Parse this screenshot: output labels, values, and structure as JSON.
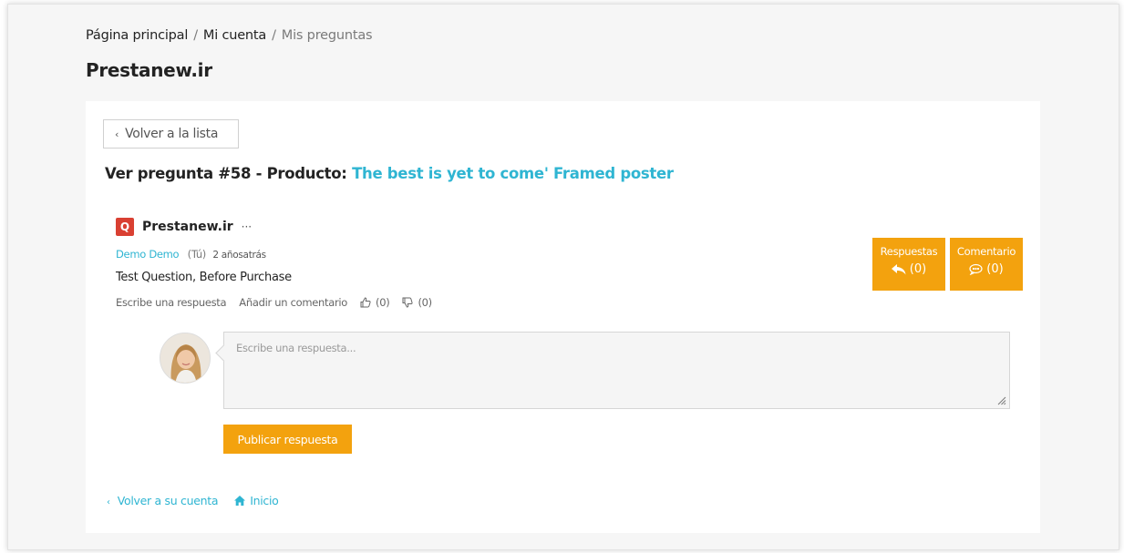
{
  "breadcrumb": {
    "items": [
      "Página principal",
      "Mi cuenta"
    ],
    "current": "Mis preguntas",
    "separator": "/"
  },
  "page": {
    "title": "Prestanew.ir"
  },
  "question": {
    "back_label": "Volver a la lista",
    "heading_prefix": "Ver pregunta #58 - Producto:",
    "product_name": "The best is yet to come' Framed poster",
    "shop_logo_letter": "Q",
    "shop_name": "Prestanew.ir",
    "more": "···",
    "author": "Demo Demo",
    "you_label": "(Tú)",
    "time": "2 añosatrás",
    "text": "Test Question, Before Purchase",
    "write_reply": "Escribe una respuesta",
    "add_comment": "Añadir un comentario",
    "likes": "(0)",
    "dislikes": "(0)"
  },
  "stats": {
    "answers_label": "Respuestas",
    "answers_count": "(0)",
    "comments_label": "Comentario",
    "comments_count": "(0)"
  },
  "reply": {
    "placeholder": "Escribe una respuesta...",
    "publish_label": "Publicar respuesta"
  },
  "footer": {
    "back_account": "Volver a su cuenta",
    "home": "Inicio"
  },
  "colors": {
    "accent": "#2fb5d2",
    "orange": "#f3a20e",
    "logo_red": "#d94032"
  },
  "icons": [
    "chevron-left-icon",
    "more-icon",
    "thumbs-up-icon",
    "thumbs-down-icon",
    "reply-icon",
    "comment-icon",
    "home-icon",
    "resize-handle-icon"
  ]
}
